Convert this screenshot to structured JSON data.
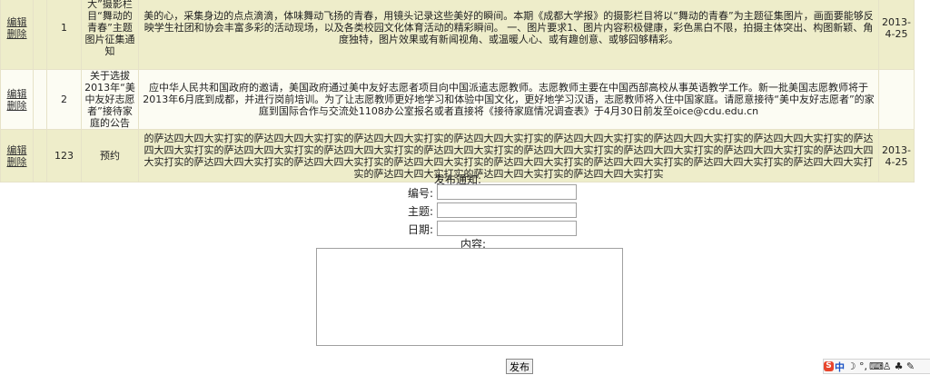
{
  "colors": {
    "row_odd": "#eeedca",
    "row_even": "#fcfcf3",
    "cell_border": "#e6e2c8"
  },
  "table": {
    "rows": [
      {
        "edit": "编辑",
        "delete": "删除",
        "id": "1",
        "title": "大”摄影栏目“舞动的青春”主题图片征集通知",
        "content": "美的心，采集身边的点点滴滴，体味舞动飞扬的青春，用镜头记录这些美好的瞬间。本期《成都大学报》的摄影栏目将以“舞动的青春”为主题征集图片，画面要能够反映学生社团和协会丰富多彩的活动现场，以及各类校园文化体育活动的精彩瞬间。 一、图片要求1、图片内容积极健康，彩色黑白不限，拍摄主体突出、构图新颖、角度独特，图片效果或有新闻视角、或温暖人心、或有趣创意、或够囧够精彩。",
        "date": "2013-4-25"
      },
      {
        "edit": "编辑",
        "delete": "删除",
        "id": "2",
        "title": "关于选拔2013年“美中友好志愿者”接待家庭的公告",
        "content": "应中华人民共和国政府的邀请，美国政府通过美中友好志愿者项目向中国派遣志愿教师。志愿教师主要在中国西部高校从事英语教学工作。新一批美国志愿教师将于2013年6月底到成都，并进行岗前培训。为了让志愿教师更好地学习和体验中国文化，更好地学习汉语，志愿教师将入住中国家庭。请愿意接待“美中友好志愿者”的家庭到国际合作与交流处1108办公室报名或者直接将《接待家庭情况调查表》于4月30日前发至oice@cdu.edu.cn",
        "date": ""
      },
      {
        "edit": "编辑",
        "delete": "删除",
        "id": "123",
        "title": "预约",
        "content": "的萨达四大四大实打实的萨达四大四大实打实的萨达四大四大实打实的萨达四大四大实打实的萨达四大四大实打实的萨达四大四大实打实的萨达四大四大实打实的萨达四大四大实打实的萨达四大四大实打实的萨达四大四大实打实的萨达四大四大实打实的萨达四大四大实打实的萨达四大四大实打实的萨达四大四大实打实的萨达四大四大实打实的萨达四大四大实打实的萨达四大四大实打实的萨达四大四大实打实的萨达四大四大实打实的萨达四大四大实打实的萨达四大四大实打实的萨达四大四大实打实的萨达四大四大实打实的萨达四大四大实打实的萨达四大四大实打实",
        "date": "2013-4-25"
      }
    ]
  },
  "form": {
    "heading": "发布通知:",
    "number_label": "编号:",
    "number_value": "",
    "subject_label": "主题:",
    "subject_value": "",
    "date_label": "日期:",
    "date_value": "",
    "content_label": "内容:",
    "content_value": "",
    "submit_label": "发布"
  },
  "ime_toolbar": {
    "logo": "S",
    "mode": "中"
  }
}
